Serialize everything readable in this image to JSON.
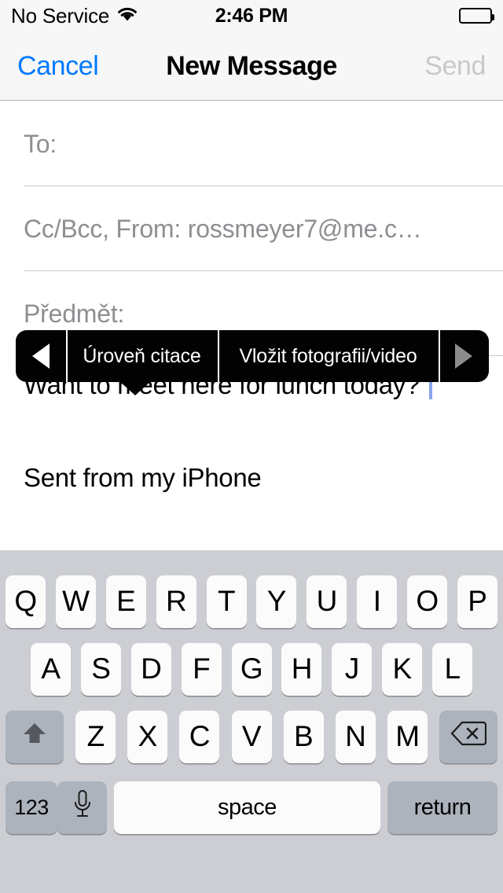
{
  "status_bar": {
    "carrier": "No Service",
    "wifi_icon": "wifi-icon",
    "time": "2:46 PM",
    "battery_icon": "battery-full-icon"
  },
  "nav_bar": {
    "cancel_label": "Cancel",
    "title": "New Message",
    "send_label": "Send",
    "cancel_color": "#007aff",
    "send_color": "#c9c9c9"
  },
  "compose": {
    "to_label": "To:",
    "to_value": "",
    "cc_label": "Cc/Bcc, From: rossmeyer7@me.c…",
    "subject_label": "Předmět:",
    "subject_value": "",
    "body_text": "Want to meet here for lunch today? ",
    "signature": "Sent from my iPhone"
  },
  "callout": {
    "prev_icon": "triangle-left-icon",
    "items": [
      {
        "label": "Úroveň citace"
      },
      {
        "label": "Vložit fotografii/video"
      }
    ],
    "next_icon": "triangle-right-icon",
    "background": "#020202",
    "text_color": "#ffffff",
    "disabled_arrow_color": "#8c8c8c"
  },
  "keyboard": {
    "row1": [
      "Q",
      "W",
      "E",
      "R",
      "T",
      "Y",
      "U",
      "I",
      "O",
      "P"
    ],
    "row2": [
      "A",
      "S",
      "D",
      "F",
      "G",
      "H",
      "J",
      "K",
      "L"
    ],
    "row3": [
      "Z",
      "X",
      "C",
      "V",
      "B",
      "N",
      "M"
    ],
    "shift_icon": "shift-up-arrow-icon",
    "delete_icon": "backspace-delete-icon",
    "numbers_label": "123",
    "mic_icon": "microphone-icon",
    "space_label": "space",
    "return_label": "return",
    "key_color": "#fbfbfb",
    "modifier_color": "#adb3bd",
    "background": "#ccced3"
  }
}
